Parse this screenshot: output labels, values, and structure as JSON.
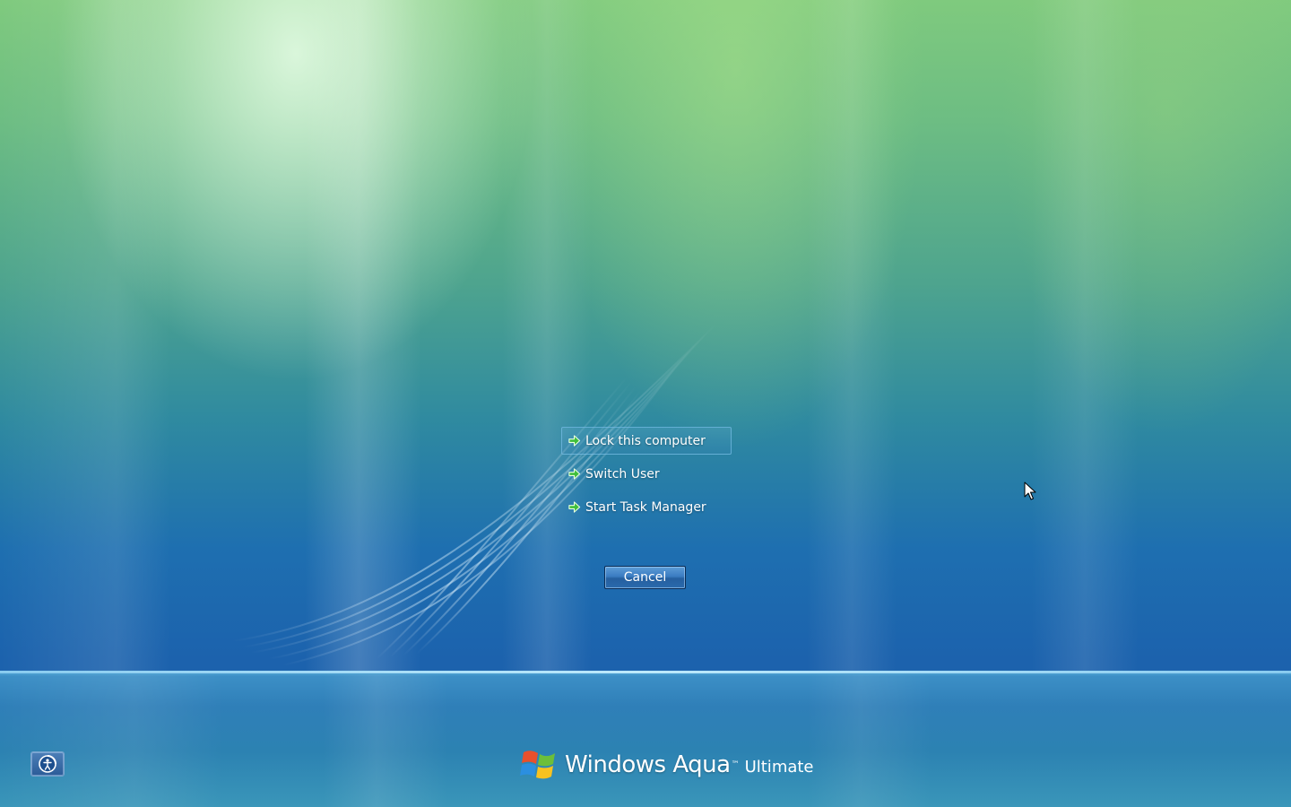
{
  "menu": {
    "items": [
      {
        "label": "Lock this computer",
        "icon": "green-arrow-icon"
      },
      {
        "label": "Switch User",
        "icon": "green-arrow-icon"
      },
      {
        "label": "Start Task Manager",
        "icon": "green-arrow-icon"
      }
    ],
    "cancel_label": "Cancel"
  },
  "ease_of_access": {
    "icon": "ease-of-access-icon"
  },
  "branding": {
    "name": "Windows Aqua",
    "trademark": "™",
    "edition": "Ultimate",
    "logo_icon": "windows-flag-icon"
  },
  "colors": {
    "background_top": "#7fca7e",
    "background_bottom": "#1e65a7",
    "button_blue": "#3b7cc1",
    "arrow_green": "#3fbf3a"
  }
}
